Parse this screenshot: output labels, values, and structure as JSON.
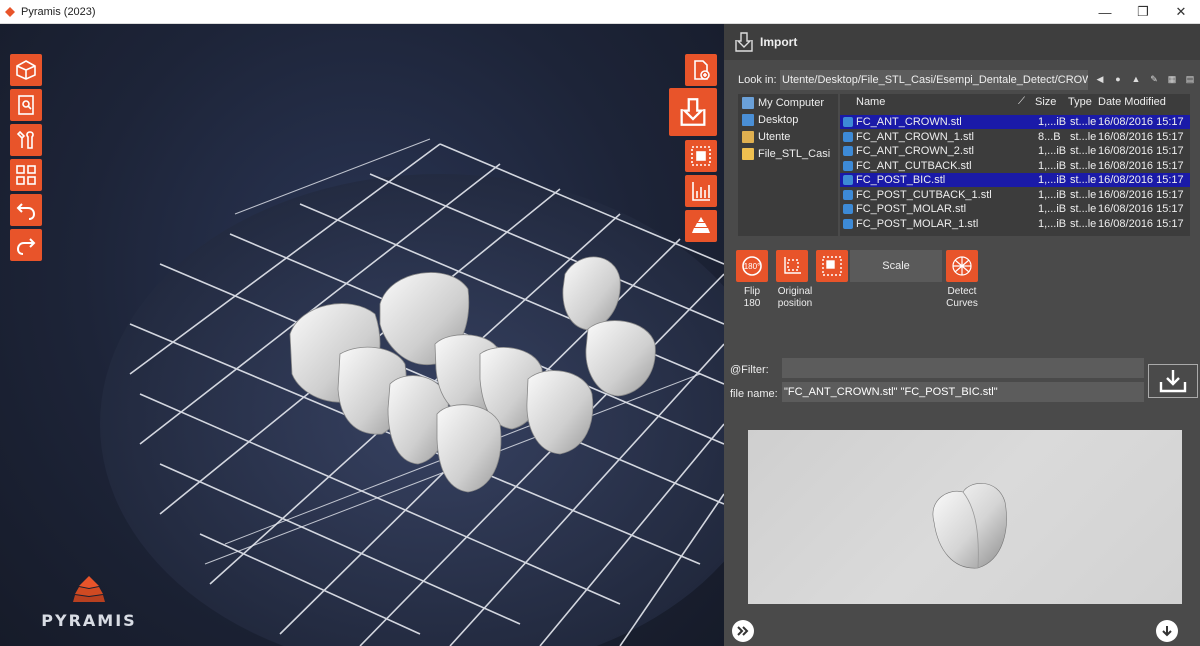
{
  "window": {
    "title": "Pyramis (2023)",
    "controls": [
      "minimize",
      "maximize",
      "close"
    ],
    "control_glyphs": {
      "minimize": "—",
      "maximize": "❐",
      "close": "✕"
    }
  },
  "toolbar_left": [
    {
      "icon": "cube-view-icon"
    },
    {
      "icon": "document-search-icon"
    },
    {
      "icon": "tools-icon"
    },
    {
      "icon": "grid-settings-icon"
    },
    {
      "icon": "undo-icon"
    },
    {
      "icon": "redo-icon"
    }
  ],
  "toolbar_right": [
    {
      "icon": "new-file-icon"
    },
    {
      "icon": "import-icon"
    },
    {
      "icon": "select-objects-icon"
    },
    {
      "icon": "statistics-icon"
    },
    {
      "icon": "layers-icon"
    }
  ],
  "logo": {
    "text": "PYRAMIS"
  },
  "import_panel": {
    "title": "Import",
    "look_in_label": "Look in:",
    "look_in_path": "Utente/Desktop/File_STL_Casi/Esempi_Dentale_Detect/CROWNS",
    "tree": [
      {
        "label": "My Computer",
        "icon": "computer-icon"
      },
      {
        "label": "Desktop",
        "icon": "desktop-folder-icon"
      },
      {
        "label": "Utente",
        "icon": "user-folder-icon"
      },
      {
        "label": "File_STL_Casi",
        "icon": "folder-icon"
      }
    ],
    "columns": {
      "name": "Name",
      "size": "Size",
      "type": "Type",
      "date": "Date Modified"
    },
    "files": [
      {
        "name": "FC_ANT_CROWN.stl",
        "size": "1,...iB",
        "type": "st...le",
        "date": "16/08/2016 15:17",
        "selected": true
      },
      {
        "name": "FC_ANT_CROWN_1.stl",
        "size": "8...B",
        "type": "st...le",
        "date": "16/08/2016 15:17",
        "selected": false
      },
      {
        "name": "FC_ANT_CROWN_2.stl",
        "size": "1,...iB",
        "type": "st...le",
        "date": "16/08/2016 15:17",
        "selected": false
      },
      {
        "name": "FC_ANT_CUTBACK.stl",
        "size": "1,...iB",
        "type": "st...le",
        "date": "16/08/2016 15:17",
        "selected": false
      },
      {
        "name": "FC_POST_BIC.stl",
        "size": "1,...iB",
        "type": "st...le",
        "date": "16/08/2016 15:17",
        "selected": true
      },
      {
        "name": "FC_POST_CUTBACK_1.stl",
        "size": "1,...iB",
        "type": "st...le",
        "date": "16/08/2016 15:17",
        "selected": false
      },
      {
        "name": "FC_POST_MOLAR.stl",
        "size": "1,...iB",
        "type": "st...le",
        "date": "16/08/2016 15:17",
        "selected": false
      },
      {
        "name": "FC_POST_MOLAR_1.stl",
        "size": "1,...iB",
        "type": "st...le",
        "date": "16/08/2016 15:17",
        "selected": false
      }
    ],
    "actions": {
      "flip": "Flip 180",
      "original_line1": "Original",
      "original_line2": "position",
      "scale": "Scale",
      "detect_line1": "Detect",
      "detect_line2": "Curves",
      "flip_badge": "180°"
    },
    "filter_label": "@Filter:",
    "filter_value": "",
    "file_name_label": "file name:",
    "file_name_value": "\"FC_ANT_CROWN.stl\" \"FC_POST_BIC.stl\""
  },
  "colors": {
    "accent": "#e8542a",
    "selection": "#1a1aa8",
    "panel_bg": "#4a4a4a",
    "viewport_bg": "#1d2438"
  }
}
